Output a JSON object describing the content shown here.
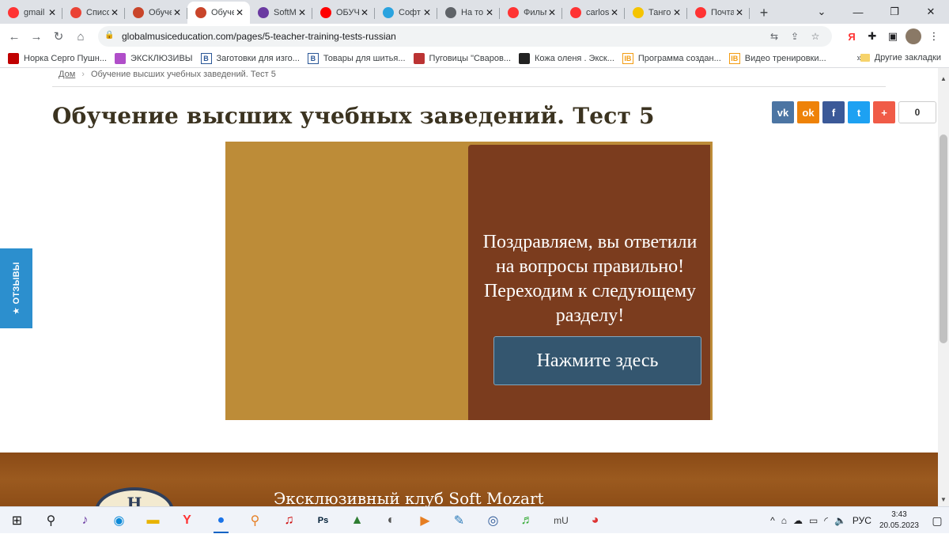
{
  "browser": {
    "tabs": [
      {
        "title": "gmail",
        "icon": "yandex-icon",
        "color": "#f33"
      },
      {
        "title": "Список",
        "icon": "gmail-icon",
        "color": "#ea4335"
      },
      {
        "title": "Обучение",
        "icon": "site-icon",
        "color": "#c9452a"
      },
      {
        "title": "Обучение",
        "icon": "site-icon",
        "color": "#c9452a",
        "active": true
      },
      {
        "title": "SoftMozart",
        "icon": "softmozart-icon",
        "color": "#6a3aa1"
      },
      {
        "title": "ОБУЧЕНИЕ",
        "icon": "youtube-icon",
        "color": "#f00"
      },
      {
        "title": "Софт",
        "icon": "telegram-icon",
        "color": "#2aa3df"
      },
      {
        "title": "На то",
        "icon": "globe-icon",
        "color": "#5f6368"
      },
      {
        "title": "Фильм",
        "icon": "yandex-icon",
        "color": "#f33"
      },
      {
        "title": "carlos",
        "icon": "yandex-icon",
        "color": "#f33"
      },
      {
        "title": "Танго",
        "icon": "play-icon",
        "color": "#f5c400"
      },
      {
        "title": "Почта",
        "icon": "yandex-icon",
        "color": "#f33"
      }
    ],
    "address": {
      "url": "globalmusiceducation.com/pages/5-teacher-training-tests-russian"
    },
    "bookmarks": [
      {
        "label": "Норка Серго Пушн...",
        "color": "#c00000"
      },
      {
        "label": "ЭКСКЛЮЗИВЫ",
        "color": "#b04ec9"
      },
      {
        "label": "Заготовки для изго...",
        "color": "#2b5797",
        "glyph": "B"
      },
      {
        "label": "Товары для шитья...",
        "color": "#2b5797",
        "glyph": "B"
      },
      {
        "label": "Пуговицы \"Сваров...",
        "color": "#b33"
      },
      {
        "label": "Кожа оленя . Экск...",
        "color": "#222"
      },
      {
        "label": "Программа создан...",
        "color": "#f39c12",
        "glyph": "IB"
      },
      {
        "label": "Видео тренировки...",
        "color": "#f39c12",
        "glyph": "IB"
      }
    ],
    "bookmarks_more": "»",
    "other_bookmarks": "Другие закладки"
  },
  "page": {
    "breadcrumb": {
      "home": "Дом",
      "current": "Обучение высших учебных заведений. Тест 5"
    },
    "title": "Обучение высших учебных заведений. Тест 5",
    "share": {
      "buttons": [
        {
          "name": "vk-share-button",
          "glyph": "vk",
          "color": "#4c75a3"
        },
        {
          "name": "odnoklassniki-share-button",
          "glyph": "ok",
          "color": "#ee8208"
        },
        {
          "name": "facebook-share-button",
          "glyph": "f",
          "color": "#3b5998"
        },
        {
          "name": "twitter-share-button",
          "glyph": "t",
          "color": "#1da1f2"
        },
        {
          "name": "more-share-button",
          "glyph": "+",
          "color": "#f05b47"
        }
      ],
      "count": "0"
    },
    "quiz": {
      "message": "Поздравляем, вы ответили на вопросы правильно! Переходим к следующему разделу!",
      "button": "Нажмите здесь"
    },
    "footer": {
      "club": "Эксклюзивный клуб Soft Mozart",
      "logo_letter": "H"
    },
    "reviews_tab": "★ ОТЗЫВЫ"
  },
  "taskbar": {
    "language": "РУС",
    "time": "3:43",
    "date": "20.05.2023"
  }
}
